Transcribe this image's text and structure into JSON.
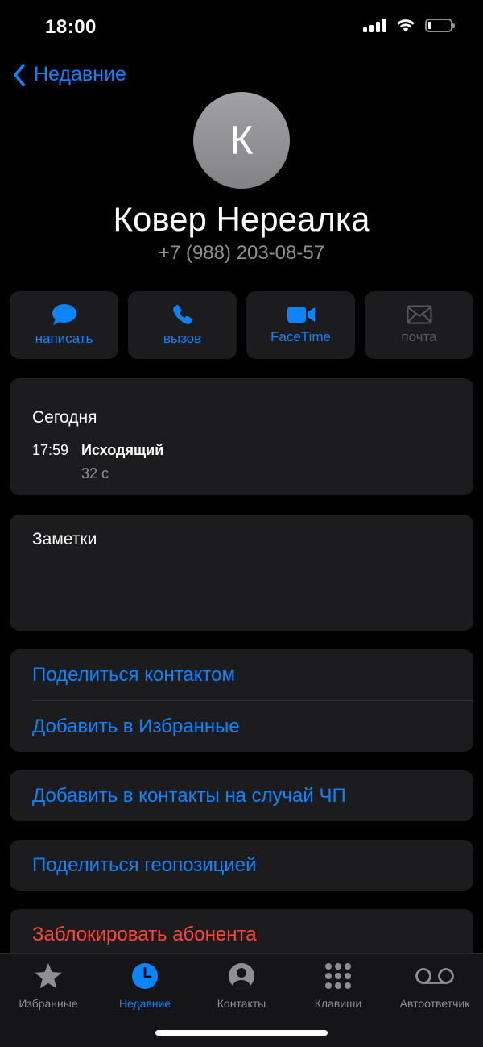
{
  "status_bar": {
    "time": "18:00"
  },
  "nav": {
    "back_label": "Недавние"
  },
  "contact": {
    "initial": "К",
    "name": "Ковер Нереалка",
    "phone": "+7 (988) 203-08-57"
  },
  "actions": [
    {
      "label": "написать",
      "icon": "message-icon"
    },
    {
      "label": "вызов",
      "icon": "phone-icon"
    },
    {
      "label": "FaceTime",
      "icon": "video-icon"
    },
    {
      "label": "почта",
      "icon": "mail-icon",
      "disabled": true
    }
  ],
  "history": {
    "title": "Сегодня",
    "time": "17:59",
    "type": "Исходящий",
    "duration": "32 с"
  },
  "notes": {
    "title": "Заметки"
  },
  "links": {
    "share_contact": "Поделиться контактом",
    "add_favorites": "Добавить в Избранные",
    "add_emergency": "Добавить в контакты на случай ЧП",
    "share_location": "Поделиться геопозицией",
    "block": "Заблокировать абонента"
  },
  "tabs": [
    {
      "label": "Избранные",
      "icon": "star-icon"
    },
    {
      "label": "Недавние",
      "icon": "clock-icon",
      "active": true
    },
    {
      "label": "Контакты",
      "icon": "person-icon"
    },
    {
      "label": "Клавиши",
      "icon": "keypad-icon"
    },
    {
      "label": "Автоответчик",
      "icon": "voicemail-icon"
    }
  ],
  "colors": {
    "accent": "#0a84ff",
    "danger": "#ff453a",
    "card": "#1c1c1e",
    "secondary": "#8e8e93"
  }
}
